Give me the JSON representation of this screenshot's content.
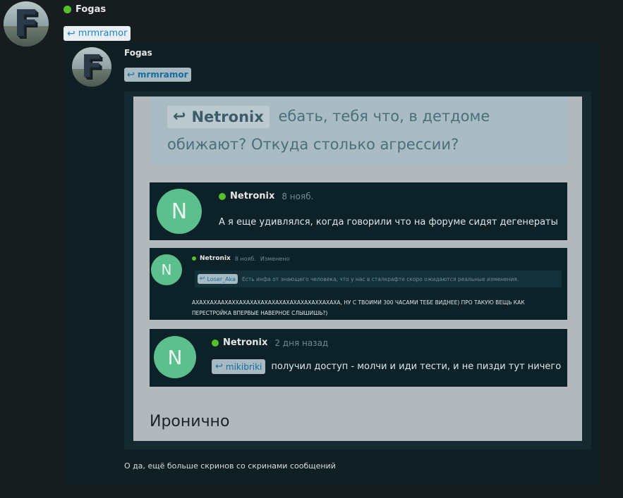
{
  "post": {
    "author": "Fogas",
    "reply_to": "mrmramor",
    "caption": "О да, ещё больше скринов со скринами сообщений"
  },
  "screenshot": {
    "author": "Fogas",
    "reply_to": "mrmramor",
    "quote": {
      "reply_to": "Netronix",
      "text": "ебать, тебя что, в детдоме обижают? Откуда столько агрессии?"
    },
    "messages": [
      {
        "avatar_letter": "N",
        "author": "Netronix",
        "time": "8 нояб.",
        "text": "А я еще удивлялся, когда говорили что на форуме сидят дегенераты..."
      },
      {
        "avatar_letter": "N",
        "author": "Netronix",
        "time": "8 нояб.",
        "edited": "Изменено",
        "quote_reply_to": "Loser_Aka",
        "quote_text": "Есть инфа от знающего человека, что у нас в сталкрафте скоро ожидаются реальные изменения.",
        "text": "АХАХХАХААХАХХАХАХАХАХАХАХАХАХАХАХАХХАХАХА, НУ С ТВОИМИ 300 ЧАСАМИ ТЕБЕ ВИДНЕЕ) ПРО ТАКУЮ ВЕЩЬ КАК ПЕРЕСТРОЙКА ВПЕРВЫЕ НАВЕРНОЕ СЛЫШИШЬ?)"
      },
      {
        "avatar_letter": "N",
        "author": "Netronix",
        "time": "2 дня назад",
        "reply_to": "mikibriki",
        "text": "получил доступ - молчи и иди тести, и не пизди тут ничего"
      }
    ],
    "footer_text": "Иронично"
  },
  "colors": {
    "page_bg": "#171c1f",
    "card_bg": "#0f1f24",
    "light_panel": "#b2b8bc",
    "quote_panel": "#a9bcc3",
    "message_bg": "#0d2228",
    "avatar_green": "#5cbf8e",
    "online_green": "#56c02b",
    "link_blue": "#1f86c9"
  },
  "icons": {
    "reply": "reply-arrow-icon",
    "online": "online-dot-icon"
  }
}
